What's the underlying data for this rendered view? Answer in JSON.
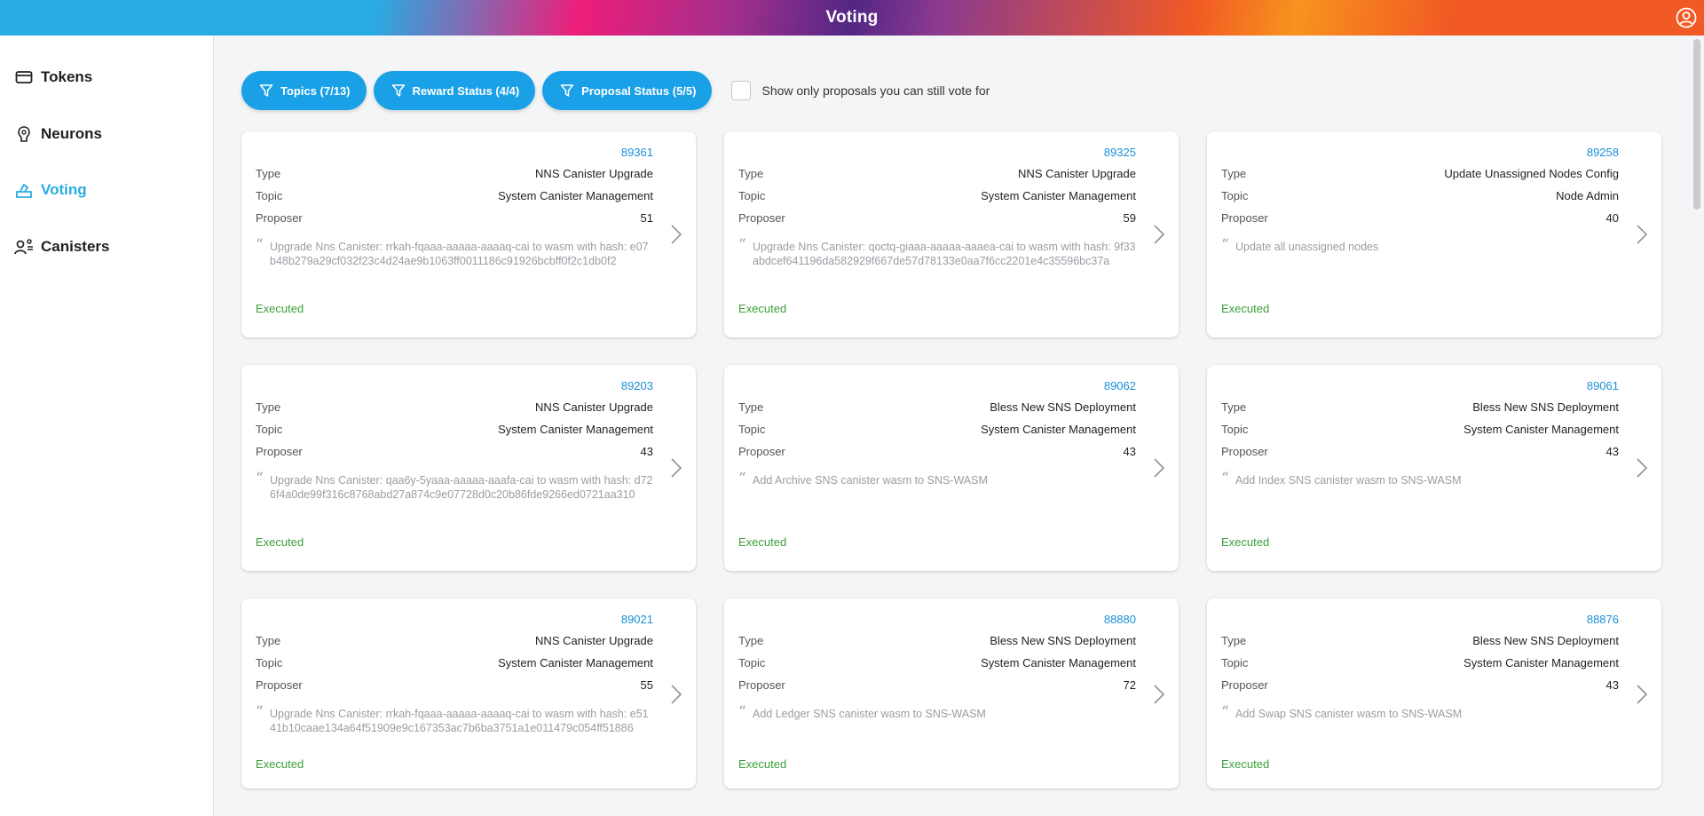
{
  "header": {
    "title": "Voting"
  },
  "sidebar": {
    "items": [
      {
        "label": "Tokens",
        "icon": "wallet-icon"
      },
      {
        "label": "Neurons",
        "icon": "neuron-icon"
      },
      {
        "label": "Voting",
        "icon": "vote-icon",
        "active": true
      },
      {
        "label": "Canisters",
        "icon": "canisters-icon"
      }
    ]
  },
  "filters": {
    "topics": "Topics (7/13)",
    "reward": "Reward Status (4/4)",
    "proposal": "Proposal Status (5/5)",
    "only_votable": "Show only proposals you can still vote for"
  },
  "labels": {
    "type": "Type",
    "topic": "Topic",
    "proposer": "Proposer"
  },
  "proposals": [
    {
      "id": "89361",
      "type": "NNS Canister Upgrade",
      "topic": "System Canister Management",
      "proposer": "51",
      "summary": "Upgrade Nns Canister: rrkah-fqaaa-aaaaa-aaaaq-cai to wasm with hash: e07b48b279a29cf032f23c4d24ae9b1063ff0011186c91926bcbff0f2c1db0f2",
      "status": "Executed"
    },
    {
      "id": "89325",
      "type": "NNS Canister Upgrade",
      "topic": "System Canister Management",
      "proposer": "59",
      "summary": "Upgrade Nns Canister: qoctq-giaaa-aaaaa-aaaea-cai to wasm with hash: 9f33abdcef641196da582929f667de57d78133e0aa7f6cc2201e4c35596bc37a",
      "status": "Executed"
    },
    {
      "id": "89258",
      "type": "Update Unassigned Nodes Config",
      "topic": "Node Admin",
      "proposer": "40",
      "summary": "Update all unassigned nodes",
      "status": "Executed"
    },
    {
      "id": "89203",
      "type": "NNS Canister Upgrade",
      "topic": "System Canister Management",
      "proposer": "43",
      "summary": "Upgrade Nns Canister: qaa6y-5yaaa-aaaaa-aaafa-cai to wasm with hash: d726f4a0de99f316c8768abd27a874c9e07728d0c20b86fde9266ed0721aa310",
      "status": "Executed"
    },
    {
      "id": "89062",
      "type": "Bless New SNS Deployment",
      "topic": "System Canister Management",
      "proposer": "43",
      "summary": "Add Archive SNS canister wasm to SNS-WASM",
      "status": "Executed"
    },
    {
      "id": "89061",
      "type": "Bless New SNS Deployment",
      "topic": "System Canister Management",
      "proposer": "43",
      "summary": "Add Index SNS canister wasm to SNS-WASM",
      "status": "Executed"
    },
    {
      "id": "89021",
      "type": "NNS Canister Upgrade",
      "topic": "System Canister Management",
      "proposer": "55",
      "summary": "Upgrade Nns Canister: rrkah-fqaaa-aaaaa-aaaaq-cai to wasm with hash: e5141b10caae134a64f51909e9c167353ac7b6ba3751a1e011479c054ff51886",
      "status": "Executed"
    },
    {
      "id": "88880",
      "type": "Bless New SNS Deployment",
      "topic": "System Canister Management",
      "proposer": "72",
      "summary": "Add Ledger SNS canister wasm to SNS-WASM",
      "status": "Executed"
    },
    {
      "id": "88876",
      "type": "Bless New SNS Deployment",
      "topic": "System Canister Management",
      "proposer": "43",
      "summary": "Add Swap SNS canister wasm to SNS-WASM",
      "status": "Executed"
    }
  ],
  "colors": {
    "accent": "#1aa0e6",
    "executed": "#3ba03b",
    "proposal_id": "#1a8fd8"
  }
}
